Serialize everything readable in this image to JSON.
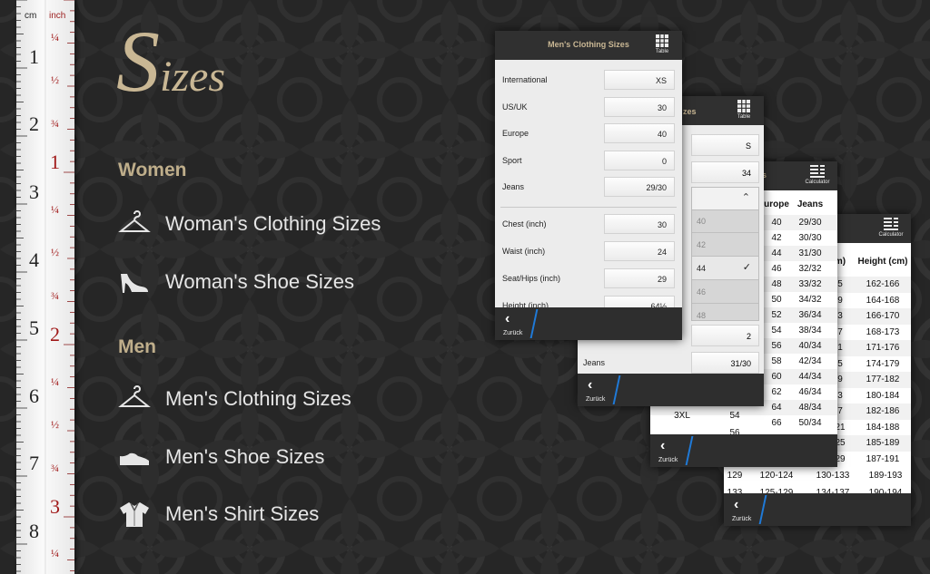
{
  "ruler": {
    "cm_label": "cm",
    "inch_label": "inch",
    "cm_numbers": [
      "1",
      "2",
      "3",
      "4",
      "5",
      "6",
      "7",
      "8"
    ],
    "inch_numbers": [
      "1",
      "2",
      "3"
    ],
    "inch_fractions": [
      "¼",
      "½",
      "¾",
      "¼",
      "½",
      "¾",
      "¼",
      "½",
      "¾",
      "¼"
    ]
  },
  "logo": {
    "first": "S",
    "rest": "izes"
  },
  "menu": {
    "women_header": "Women",
    "men_header": "Men",
    "items": [
      {
        "label": "Woman's Clothing Sizes",
        "icon": "hanger-icon"
      },
      {
        "label": "Woman's Shoe Sizes",
        "icon": "high-heel-icon"
      },
      {
        "label": "Men's Clothing Sizes",
        "icon": "hanger-icon"
      },
      {
        "label": "Men's Shoe Sizes",
        "icon": "mens-shoe-icon"
      },
      {
        "label": "Men's Shirt Sizes",
        "icon": "shirt-icon"
      }
    ]
  },
  "screens": {
    "front": {
      "title": "Men's Clothing Sizes",
      "header_button": "Table",
      "rows": [
        {
          "label": "International",
          "value": "XS"
        },
        {
          "label": "US/UK",
          "value": "30"
        },
        {
          "label": "Europe",
          "value": "40"
        },
        {
          "label": "Sport",
          "value": "0"
        },
        {
          "label": "Jeans",
          "value": "29/30"
        },
        {
          "label": "Chest (inch)",
          "value": "30"
        },
        {
          "label": "Waist (inch)",
          "value": "24"
        },
        {
          "label": "Seat/Hips (inch)",
          "value": "29"
        },
        {
          "label": "Height (inch)",
          "value": "64½"
        }
      ],
      "back_label": "Zurück"
    },
    "second": {
      "title_fragment": "zes",
      "header_button": "Table",
      "field_values": [
        "S",
        "34",
        "2",
        "31/30"
      ],
      "dropdown_options": [
        "40",
        "42",
        "44",
        "46",
        "48"
      ],
      "dropdown_selected": "44",
      "jeans_label": "Jeans",
      "back_label": "Zurück"
    },
    "third": {
      "title_fragment": "es",
      "header_button": "Calculator",
      "headers": [
        "urope",
        "Jeans"
      ],
      "rows": [
        [
          "40",
          "29/30"
        ],
        [
          "42",
          "30/30"
        ],
        [
          "44",
          "31/30"
        ],
        [
          "46",
          "32/32"
        ],
        [
          "48",
          "33/32"
        ],
        [
          "50",
          "34/32"
        ],
        [
          "52",
          "36/34"
        ],
        [
          "54",
          "38/34"
        ],
        [
          "56",
          "40/34"
        ],
        [
          "58",
          "42/34"
        ],
        [
          "60",
          "44/34"
        ],
        [
          "62",
          "46/34"
        ],
        [
          "64",
          "48/34"
        ],
        [
          "66",
          "50/34"
        ]
      ],
      "left_fragments": [
        "3XL",
        "54",
        "56"
      ],
      "back_label": "Zurück"
    },
    "fourth": {
      "title_fragment": "es",
      "header_button": "Calculator",
      "headers": [
        "m)",
        "Height (cm)"
      ],
      "rows": [
        [
          "5",
          "162-166"
        ],
        [
          "9",
          "164-168"
        ],
        [
          "3",
          "166-170"
        ],
        [
          "7",
          "168-173"
        ],
        [
          "1",
          "171-176"
        ],
        [
          "5",
          "174-179"
        ],
        [
          "9",
          "177-182"
        ],
        [
          "3",
          "180-184"
        ],
        [
          "7",
          "182-186"
        ],
        [
          "21",
          "184-188"
        ],
        [
          "25",
          "185-189"
        ],
        [
          "29",
          "187-191"
        ]
      ],
      "full_row": [
        "129",
        "120-124",
        "130-133",
        "189-193"
      ],
      "cut_row": [
        "133",
        "125-129",
        "134-137",
        "190-194"
      ],
      "back_label": "Zurück"
    }
  },
  "colors": {
    "accent_gold": "#c9b794",
    "blue_divider": "#1f7ad8",
    "menu_text": "#e6e6e6"
  }
}
